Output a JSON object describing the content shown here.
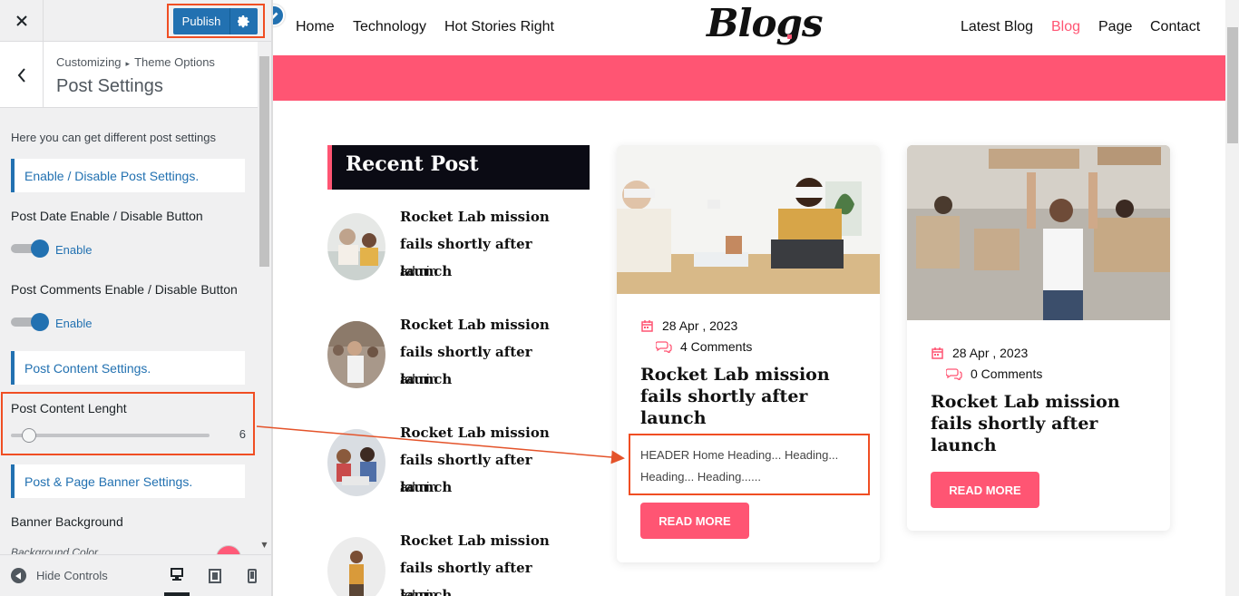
{
  "customizer": {
    "publish_label": "Publish",
    "breadcrumb_root": "Customizing",
    "breadcrumb_section": "Theme Options",
    "section_title": "Post Settings",
    "description": "Here you can get different post settings",
    "group_enable_disable": "Enable / Disable Post Settings.",
    "post_date_label": "Post Date Enable / Disable Button",
    "post_date_toggle": "Enable",
    "post_comments_label": "Post Comments Enable / Disable Button",
    "post_comments_toggle": "Enable",
    "group_content": "Post Content Settings.",
    "content_length_label": "Post Content Lenght",
    "content_length_value": "6",
    "group_banner": "Post & Page Banner Settings.",
    "banner_background_label": "Banner Background",
    "background_color_label": "Background Color",
    "background_color_value": "#ff5a78",
    "hide_controls_label": "Hide Controls",
    "devices": [
      "desktop-icon",
      "tablet-icon",
      "mobile-icon"
    ]
  },
  "site": {
    "logo_text": "Blogs",
    "nav_left": [
      "Home",
      "Technology",
      "Hot Stories Right"
    ],
    "nav_right": [
      "Latest Blog",
      "Blog",
      "Page",
      "Contact"
    ],
    "active_nav": "Blog",
    "accent_color": "#ff5573"
  },
  "sidebar": {
    "title": "Recent Post",
    "posts": [
      {
        "title": "Rocket Lab mission fails shortly after launch",
        "author": "admin"
      },
      {
        "title": "Rocket Lab mission fails shortly after launch",
        "author": "admin"
      },
      {
        "title": "Rocket Lab mission fails shortly after launch",
        "author": "admin"
      },
      {
        "title": "Rocket Lab mission fails shortly after launch",
        "author": "admin"
      }
    ]
  },
  "cards": [
    {
      "date": "28  Apr , 2023",
      "comments": "4 Comments",
      "title": "Rocket Lab mission fails shortly after launch",
      "excerpt": "HEADER Home Heading... Heading... Heading... Heading......",
      "button": "READ MORE"
    },
    {
      "date": "28  Apr , 2023",
      "comments": "0 Comments",
      "title": "Rocket Lab mission fails shortly after launch",
      "button": "READ MORE"
    }
  ]
}
